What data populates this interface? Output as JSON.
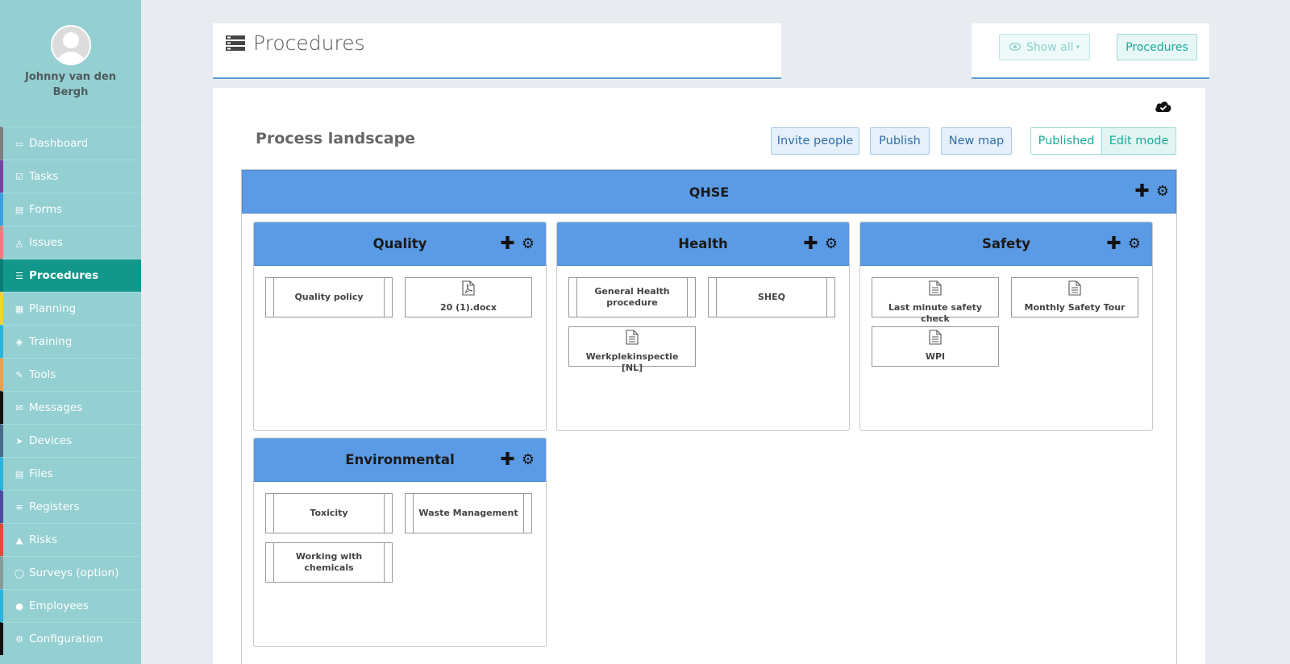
{
  "user": {
    "name": "Johnny van den Bergh"
  },
  "nav": [
    {
      "label": "Dashboard",
      "icon": "monitor-icon",
      "color": "#7d7d7d"
    },
    {
      "label": "Tasks",
      "icon": "check-square-icon",
      "color": "#7b3fa0"
    },
    {
      "label": "Forms",
      "icon": "file-icon",
      "color": "#3aa0e0"
    },
    {
      "label": "Issues",
      "icon": "bell-icon",
      "color": "#e87f7f"
    },
    {
      "label": "Procedures",
      "icon": "list-icon",
      "color": "#0a7d72"
    },
    {
      "label": "Planning",
      "icon": "calendar-icon",
      "color": "#f2d13a"
    },
    {
      "label": "Training",
      "icon": "graduation-cap-icon",
      "color": "#2bb3e0"
    },
    {
      "label": "Tools",
      "icon": "wrench-icon",
      "color": "#f0a04b"
    },
    {
      "label": "Messages",
      "icon": "envelope-icon",
      "color": "#111111"
    },
    {
      "label": "Devices",
      "icon": "rocket-icon",
      "color": "#4a6a8a"
    },
    {
      "label": "Files",
      "icon": "file-pdf-icon",
      "color": "#2bb3e0"
    },
    {
      "label": "Registers",
      "icon": "bars-icon",
      "color": "#4a4aa0"
    },
    {
      "label": "Risks",
      "icon": "warning-icon",
      "color": "#e04a3a"
    },
    {
      "label": "Surveys (option)",
      "icon": "comment-icon",
      "color": "#8a9a9a"
    },
    {
      "label": "Employees",
      "icon": "users-icon",
      "color": "#2bb3e0"
    },
    {
      "label": "Configuration",
      "icon": "gear-icon",
      "color": "#111111"
    }
  ],
  "header": {
    "title": "Procedures",
    "show_all": "Show all",
    "procedures_button": "Procedures"
  },
  "main": {
    "title": "Process landscape",
    "buttons": {
      "invite": "Invite people",
      "publish": "Publish",
      "new_map": "New map",
      "published": "Published",
      "edit_mode": "Edit mode"
    },
    "root": {
      "title": "QHSE"
    },
    "groups": [
      {
        "title": "Quality",
        "items": [
          {
            "label": "Quality policy",
            "type": "process"
          },
          {
            "label": "20 (1).docx",
            "type": "pdf"
          }
        ]
      },
      {
        "title": "Health",
        "items": [
          {
            "label": "General Health procedure",
            "type": "process"
          },
          {
            "label": "SHEQ",
            "type": "process"
          },
          {
            "label": "Werkplekinspectie [NL]",
            "type": "document"
          }
        ]
      },
      {
        "title": "Safety",
        "items": [
          {
            "label": "Last minute safety check",
            "type": "document"
          },
          {
            "label": "Monthly Safety Tour",
            "type": "document"
          },
          {
            "label": "WPI",
            "type": "document"
          }
        ]
      },
      {
        "title": "Environmental",
        "items": [
          {
            "label": "Toxicity",
            "type": "process"
          },
          {
            "label": "Waste Management",
            "type": "process"
          },
          {
            "label": "Working with chemicals",
            "type": "process"
          }
        ]
      }
    ]
  },
  "colors": {
    "sidebar": "#94cfd2",
    "active": "#12978a",
    "bar": "#5b9be5",
    "accent": "#1aa99a"
  }
}
